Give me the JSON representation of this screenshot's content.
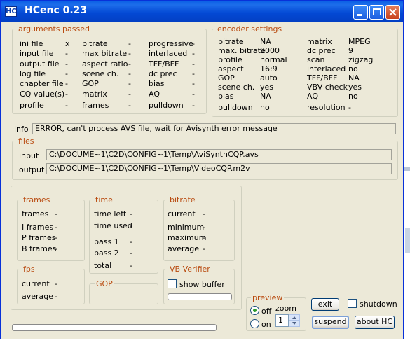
{
  "window": {
    "title": "HCenc 0.23",
    "icon": "HC"
  },
  "arguments": {
    "label": "arguments passed",
    "col1": [
      {
        "name": "ini file",
        "value": "x"
      },
      {
        "name": "input file",
        "value": "-"
      },
      {
        "name": "output file",
        "value": "-"
      },
      {
        "name": "log file",
        "value": "-"
      },
      {
        "name": "chapter file",
        "value": "-"
      },
      {
        "name": "CQ value(s)",
        "value": "-"
      },
      {
        "name": "profile",
        "value": "-"
      }
    ],
    "col2": [
      {
        "name": "bitrate",
        "value": "-"
      },
      {
        "name": "max bitrate",
        "value": "-"
      },
      {
        "name": "aspect ratio",
        "value": "-"
      },
      {
        "name": "scene ch.",
        "value": "-"
      },
      {
        "name": "GOP",
        "value": "-"
      },
      {
        "name": "matrix",
        "value": "-"
      },
      {
        "name": "frames",
        "value": "-"
      }
    ],
    "col3": [
      {
        "name": "progressive",
        "value": "-"
      },
      {
        "name": "interlaced",
        "value": "-"
      },
      {
        "name": "TFF/BFF",
        "value": "-"
      },
      {
        "name": "dc prec",
        "value": "-"
      },
      {
        "name": "bias",
        "value": "-"
      },
      {
        "name": "AQ",
        "value": "-"
      },
      {
        "name": "pulldown",
        "value": "-"
      }
    ]
  },
  "encoder": {
    "label": "encoder settings",
    "col1": [
      {
        "name": "bitrate",
        "value": "NA"
      },
      {
        "name": "max. bitrate",
        "value": "9000"
      },
      {
        "name": "profile",
        "value": "normal"
      },
      {
        "name": "aspect",
        "value": "16:9"
      },
      {
        "name": "GOP",
        "value": "auto"
      },
      {
        "name": "scene ch.",
        "value": "yes"
      },
      {
        "name": "bias",
        "value": "NA"
      },
      {
        "name": "pulldown",
        "value": "no"
      }
    ],
    "col2": [
      {
        "name": "matrix",
        "value": "MPEG"
      },
      {
        "name": "dc prec",
        "value": "9"
      },
      {
        "name": "scan",
        "value": "zigzag"
      },
      {
        "name": "interlaced",
        "value": "no"
      },
      {
        "name": "TFF/BFF",
        "value": "NA"
      },
      {
        "name": "VBV check",
        "value": "yes"
      },
      {
        "name": "AQ",
        "value": "no"
      },
      {
        "name": "resolution",
        "value": "-"
      }
    ]
  },
  "info": {
    "label": "info",
    "message": "ERROR, can't process AVS file, wait for Avisynth error message"
  },
  "files": {
    "label": "files",
    "input_label": "input",
    "input_value": "C:\\DOCUME~1\\C2D\\CONFIG~1\\Temp\\AviSynthCQP.avs",
    "output_label": "output",
    "output_value": "C:\\DOCUME~1\\C2D\\CONFIG~1\\Temp\\VideoCQP.m2v"
  },
  "frames": {
    "label": "frames",
    "rows": [
      {
        "name": "frames",
        "value": "-"
      },
      {
        "name": "I frames",
        "value": "-"
      },
      {
        "name": "P frames",
        "value": "-"
      },
      {
        "name": "B frames",
        "value": "-"
      }
    ]
  },
  "time": {
    "label": "time",
    "rows": [
      {
        "name": "time left",
        "value": "-"
      },
      {
        "name": "time used",
        "value": "-"
      },
      {
        "name": "pass 1",
        "value": "-"
      },
      {
        "name": "pass 2",
        "value": "-"
      },
      {
        "name": "total",
        "value": "-"
      }
    ]
  },
  "bitrate_stats": {
    "label": "bitrate",
    "rows": [
      {
        "name": "current",
        "value": "-"
      },
      {
        "name": "minimum",
        "value": "-"
      },
      {
        "name": "maximum",
        "value": "-"
      },
      {
        "name": "average",
        "value": "-"
      }
    ]
  },
  "fps": {
    "label": "fps",
    "rows": [
      {
        "name": "current",
        "value": "-"
      },
      {
        "name": "average",
        "value": "-"
      }
    ]
  },
  "gop": {
    "label": "GOP"
  },
  "vbv": {
    "label": "VB Verifier",
    "show_buffer_label": "show buffer",
    "show_buffer_checked": false,
    "buffer_level": 0
  },
  "preview": {
    "label": "preview",
    "off_label": "off",
    "on_label": "on",
    "selected": "off",
    "zoom_label": "zoom",
    "zoom_value": "1"
  },
  "buttons": {
    "exit": "exit",
    "shutdown": "shutdown",
    "shutdown_checked": false,
    "suspend": "suspend",
    "about": "about  HC"
  },
  "progress": {
    "value": 0
  },
  "colors": {
    "titlebar": "#0a5fe4",
    "group_label": "#b94b10",
    "window_bg": "#ece9d8"
  }
}
